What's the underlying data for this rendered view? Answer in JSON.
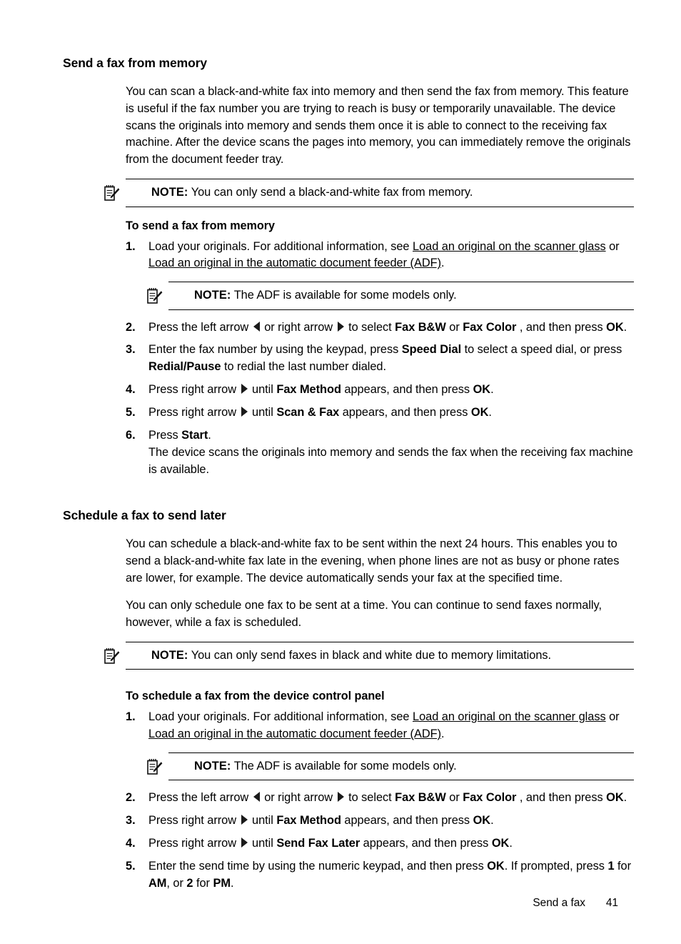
{
  "page": {
    "background": "#ffffff",
    "text_color": "#000000"
  },
  "sections": [
    {
      "heading": "Send a fax from memory",
      "intro": "You can scan a black-and-white fax into memory and then send the fax from memory. This feature is useful if the fax number you are trying to reach is busy or temporarily unavailable. The device scans the originals into memory and sends them once it is able to connect to the receiving fax machine. After the device scans the pages into memory, you can immediately remove the originals from the document feeder tray.",
      "note": {
        "label": "NOTE:",
        "text": "You can only send a black-and-white fax from memory.",
        "icon": "note-pad-pencil-icon"
      },
      "procedure_heading": "To send a fax from memory",
      "steps": {
        "s1_num": "1.",
        "s1_a": "Load your originals. For additional information, see ",
        "s1_link1": "Load an original on the scanner glass",
        "s1_b": " or ",
        "s1_link2": "Load an original in the automatic document feeder (ADF)",
        "s1_c": ".",
        "s1_note_label": "NOTE:",
        "s1_note_text": "The ADF is available for some models only.",
        "s2_num": "2.",
        "s2_a": "Press the left arrow ",
        "s2_b": " or right arrow ",
        "s2_c": " to select ",
        "s2_bold1": "Fax B&W",
        "s2_d": " or ",
        "s2_bold2": "Fax Color ",
        "s2_e": ", and then press ",
        "s2_bold3": "OK",
        "s2_f": ".",
        "s3_num": "3.",
        "s3_a": "Enter the fax number by using the keypad, press ",
        "s3_bold1": "Speed Dial",
        "s3_b": " to select a speed dial, or press ",
        "s3_bold2": "Redial/Pause",
        "s3_c": " to redial the last number dialed.",
        "s4_num": "4.",
        "s4_a": "Press right arrow ",
        "s4_b": " until ",
        "s4_bold1": "Fax Method",
        "s4_c": " appears, and then press ",
        "s4_bold2": "OK",
        "s4_d": ".",
        "s5_num": "5.",
        "s5_a": "Press right arrow ",
        "s5_b": " until ",
        "s5_bold1": "Scan & Fax",
        "s5_c": " appears, and then press ",
        "s5_bold2": "OK",
        "s5_d": ".",
        "s6_num": "6.",
        "s6_a": "Press ",
        "s6_bold1": "Start",
        "s6_b": ".",
        "s6_sub": "The device scans the originals into memory and sends the fax when the receiving fax machine is available."
      }
    },
    {
      "heading": "Schedule a fax to send later",
      "intro1": "You can schedule a black-and-white fax to be sent within the next 24 hours. This enables you to send a black-and-white fax late in the evening, when phone lines are not as busy or phone rates are lower, for example. The device automatically sends your fax at the specified time.",
      "intro2": "You can only schedule one fax to be sent at a time. You can continue to send faxes normally, however, while a fax is scheduled.",
      "note": {
        "label": "NOTE:",
        "text": "You can only send faxes in black and white due to memory limitations.",
        "icon": "note-pad-pencil-icon"
      },
      "procedure_heading": "To schedule a fax from the device control panel",
      "steps": {
        "s1_num": "1.",
        "s1_a": "Load your originals. For additional information, see ",
        "s1_link1": "Load an original on the scanner glass",
        "s1_b": " or ",
        "s1_link2": "Load an original in the automatic document feeder (ADF)",
        "s1_c": ".",
        "s1_note_label": "NOTE:",
        "s1_note_text": "The ADF is available for some models only.",
        "s2_num": "2.",
        "s2_a": "Press the left arrow ",
        "s2_b": " or right arrow ",
        "s2_c": " to select ",
        "s2_bold1": "Fax B&W",
        "s2_d": " or ",
        "s2_bold2": "Fax Color ",
        "s2_e": ", and then press ",
        "s2_bold3": "OK",
        "s2_f": ".",
        "s3_num": "3.",
        "s3_a": "Press right arrow ",
        "s3_b": " until ",
        "s3_bold1": "Fax Method",
        "s3_c": " appears, and then press ",
        "s3_bold2": "OK",
        "s3_d": ".",
        "s4_num": "4.",
        "s4_a": "Press right arrow ",
        "s4_b": " until ",
        "s4_bold1": "Send Fax Later",
        "s4_c": " appears, and then press ",
        "s4_bold2": "OK",
        "s4_d": ".",
        "s5_num": "5.",
        "s5_a": "Enter the send time by using the numeric keypad, and then press ",
        "s5_bold1": "OK",
        "s5_b": ". If prompted, press ",
        "s5_bold2": "1",
        "s5_c": " for ",
        "s5_bold3": "AM",
        "s5_d": ", or ",
        "s5_bold4": "2",
        "s5_e": " for ",
        "s5_bold5": "PM",
        "s5_f": "."
      }
    }
  ],
  "footer": {
    "title": "Send a fax",
    "page_number": "41"
  }
}
